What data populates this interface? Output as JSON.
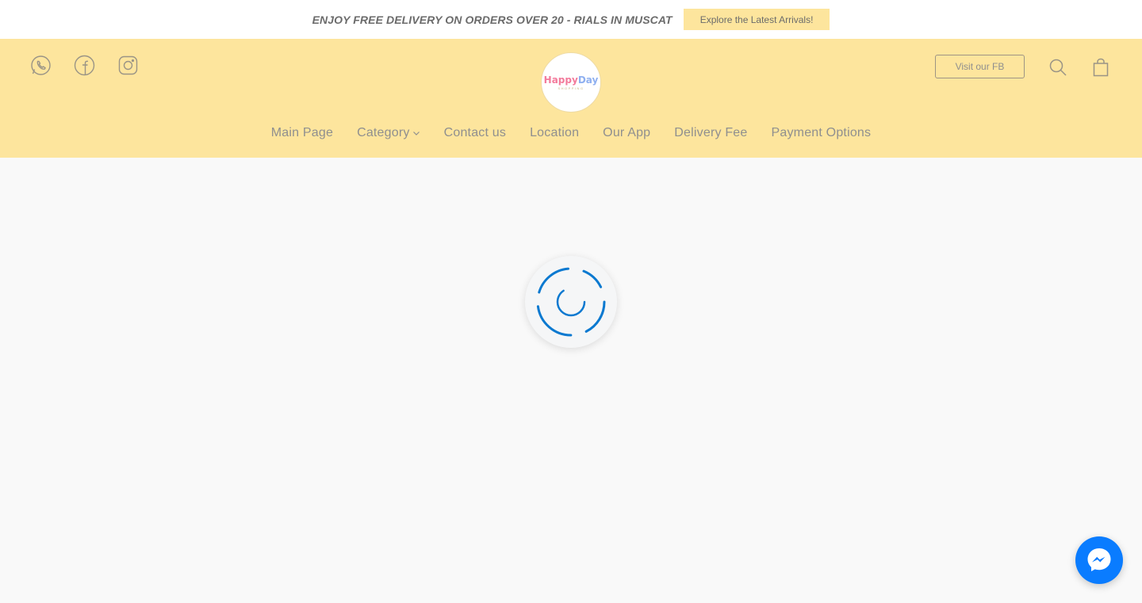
{
  "promo": {
    "text": "ENJOY FREE DELIVERY ON ORDERS OVER 20 - RIALS IN MUSCAT",
    "button_label": "Explore the Latest Arrivals!"
  },
  "header": {
    "social_icons": [
      "whatsapp-icon",
      "facebook-icon",
      "instagram-icon"
    ],
    "logo": {
      "title": "HappyDay",
      "subtitle": "SHOPPING"
    },
    "fb_button_label": "Visit our FB",
    "right_icons": [
      "search-icon",
      "shopping-bag-icon"
    ]
  },
  "nav": {
    "items": [
      {
        "label": "Main Page"
      },
      {
        "label": "Category"
      },
      {
        "label": "Contact us"
      },
      {
        "label": "Location"
      },
      {
        "label": "Our App"
      },
      {
        "label": "Delivery Fee"
      },
      {
        "label": "Payment Options"
      }
    ]
  },
  "colors": {
    "header_bg": "#fde59d",
    "page_bg": "#f9f9f9",
    "text_gray": "#8f8f8f",
    "spinner_blue": "#0b79d0",
    "messenger_blue": "#0a7cff"
  },
  "status": {
    "loading_icon": "loading-spinner-icon"
  },
  "messenger": {
    "icon": "messenger-icon"
  }
}
